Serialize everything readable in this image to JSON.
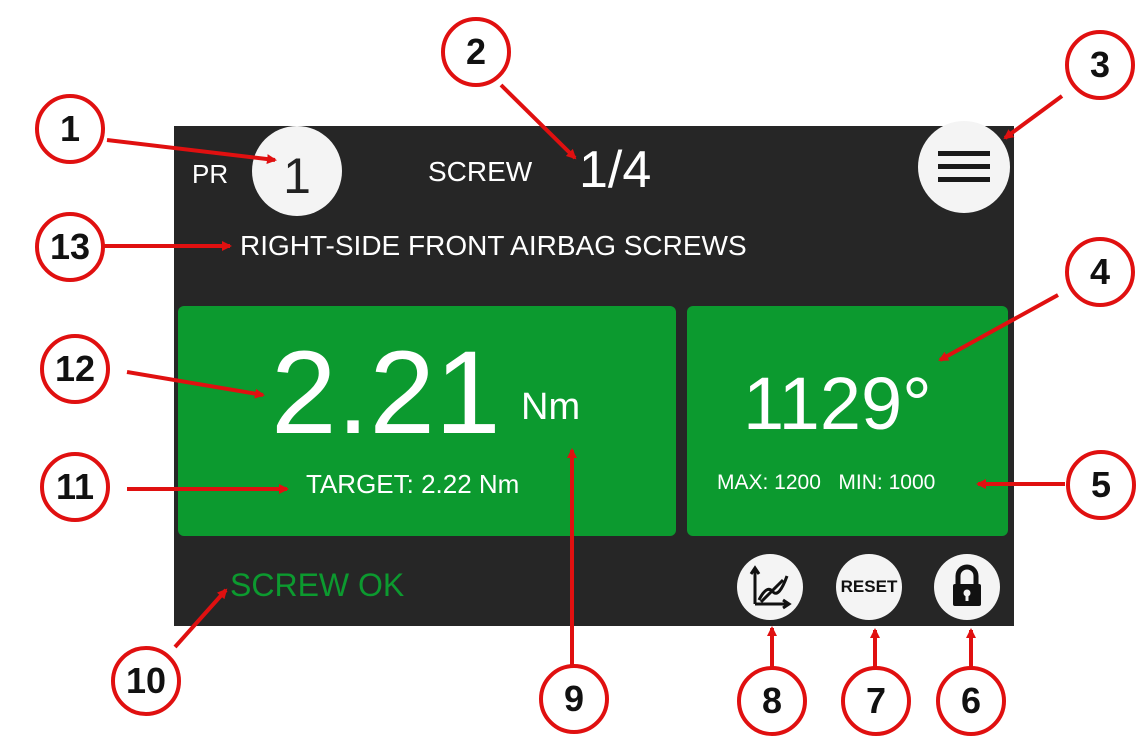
{
  "header": {
    "program_label": "PR",
    "program_number": "1",
    "screw_label": "SCREW",
    "screw_count": "1/4",
    "menu_icon": "hamburger-menu-icon"
  },
  "program_name": "RIGHT-SIDE FRONT AIRBAG  SCREWS",
  "torque": {
    "value": "2.21",
    "unit": "Nm",
    "target": "TARGET: 2.22 Nm"
  },
  "angle": {
    "value": "1129°",
    "max": "MAX: 1200",
    "min": "MIN: 1000"
  },
  "status": "SCREW OK",
  "buttons": {
    "graph_icon": "graph-icon",
    "reset_label": "RESET",
    "lock_icon": "lock-icon"
  },
  "callouts": [
    "1",
    "2",
    "3",
    "4",
    "5",
    "6",
    "7",
    "8",
    "9",
    "10",
    "11",
    "12",
    "13"
  ],
  "colors": {
    "screen_bg": "#262626",
    "card_green": "#0c9a2f",
    "status_green": "#0c9a2f",
    "callout_red": "#e01010",
    "button_bg": "#f4f4f4"
  }
}
